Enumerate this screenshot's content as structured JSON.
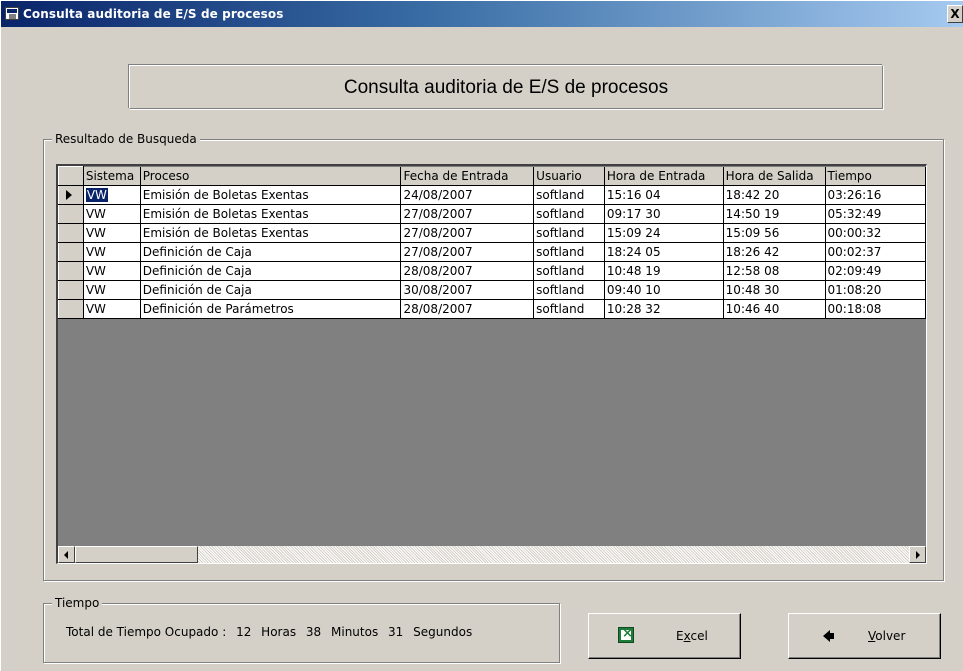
{
  "window": {
    "title": "Consulta auditoria de E/S de procesos",
    "close_label": "X"
  },
  "header": {
    "title": "Consulta auditoria de E/S de procesos"
  },
  "results": {
    "legend": "Resultado de Busqueda",
    "columns": [
      "Sistema",
      "Proceso",
      "Fecha de Entrada",
      "Usuario",
      "Hora de Entrada",
      "Hora de Salida",
      "Tiempo"
    ],
    "rows": [
      [
        "VW",
        "Emisión de Boletas Exentas",
        "24/08/2007",
        "softland",
        "15:16 04",
        "18:42 20",
        "03:26:16"
      ],
      [
        "VW",
        "Emisión de Boletas Exentas",
        "27/08/2007",
        "softland",
        "09:17 30",
        "14:50 19",
        "05:32:49"
      ],
      [
        "VW",
        "Emisión de Boletas Exentas",
        "27/08/2007",
        "softland",
        "15:09 24",
        "15:09 56",
        "00:00:32"
      ],
      [
        "VW",
        "Definición de Caja",
        "27/08/2007",
        "softland",
        "18:24 05",
        "18:26 42",
        "00:02:37"
      ],
      [
        "VW",
        "Definición de Caja",
        "28/08/2007",
        "softland",
        "10:48 19",
        "12:58 08",
        "02:09:49"
      ],
      [
        "VW",
        "Definición de Caja",
        "30/08/2007",
        "softland",
        "09:40 10",
        "10:48 30",
        "01:08:20"
      ],
      [
        "VW",
        "Definición de Parámetros",
        "28/08/2007",
        "softland",
        "10:28 32",
        "10:46 40",
        "00:18:08"
      ]
    ]
  },
  "tiempo": {
    "legend": "Tiempo",
    "label": "Total de Tiempo Ocupado :",
    "hours": "12",
    "hours_unit": "Horas",
    "minutes": "38",
    "minutes_unit": "Minutos",
    "seconds": "31",
    "seconds_unit": "Segundos"
  },
  "buttons": {
    "excel_first": "E",
    "excel_underlined": "x",
    "excel_rest": "cel",
    "volver_underlined": "V",
    "volver_rest": "olver"
  },
  "icons": {
    "title": "window-app-icon",
    "excel": "excel-icon",
    "volver": "back-arrow-icon"
  }
}
